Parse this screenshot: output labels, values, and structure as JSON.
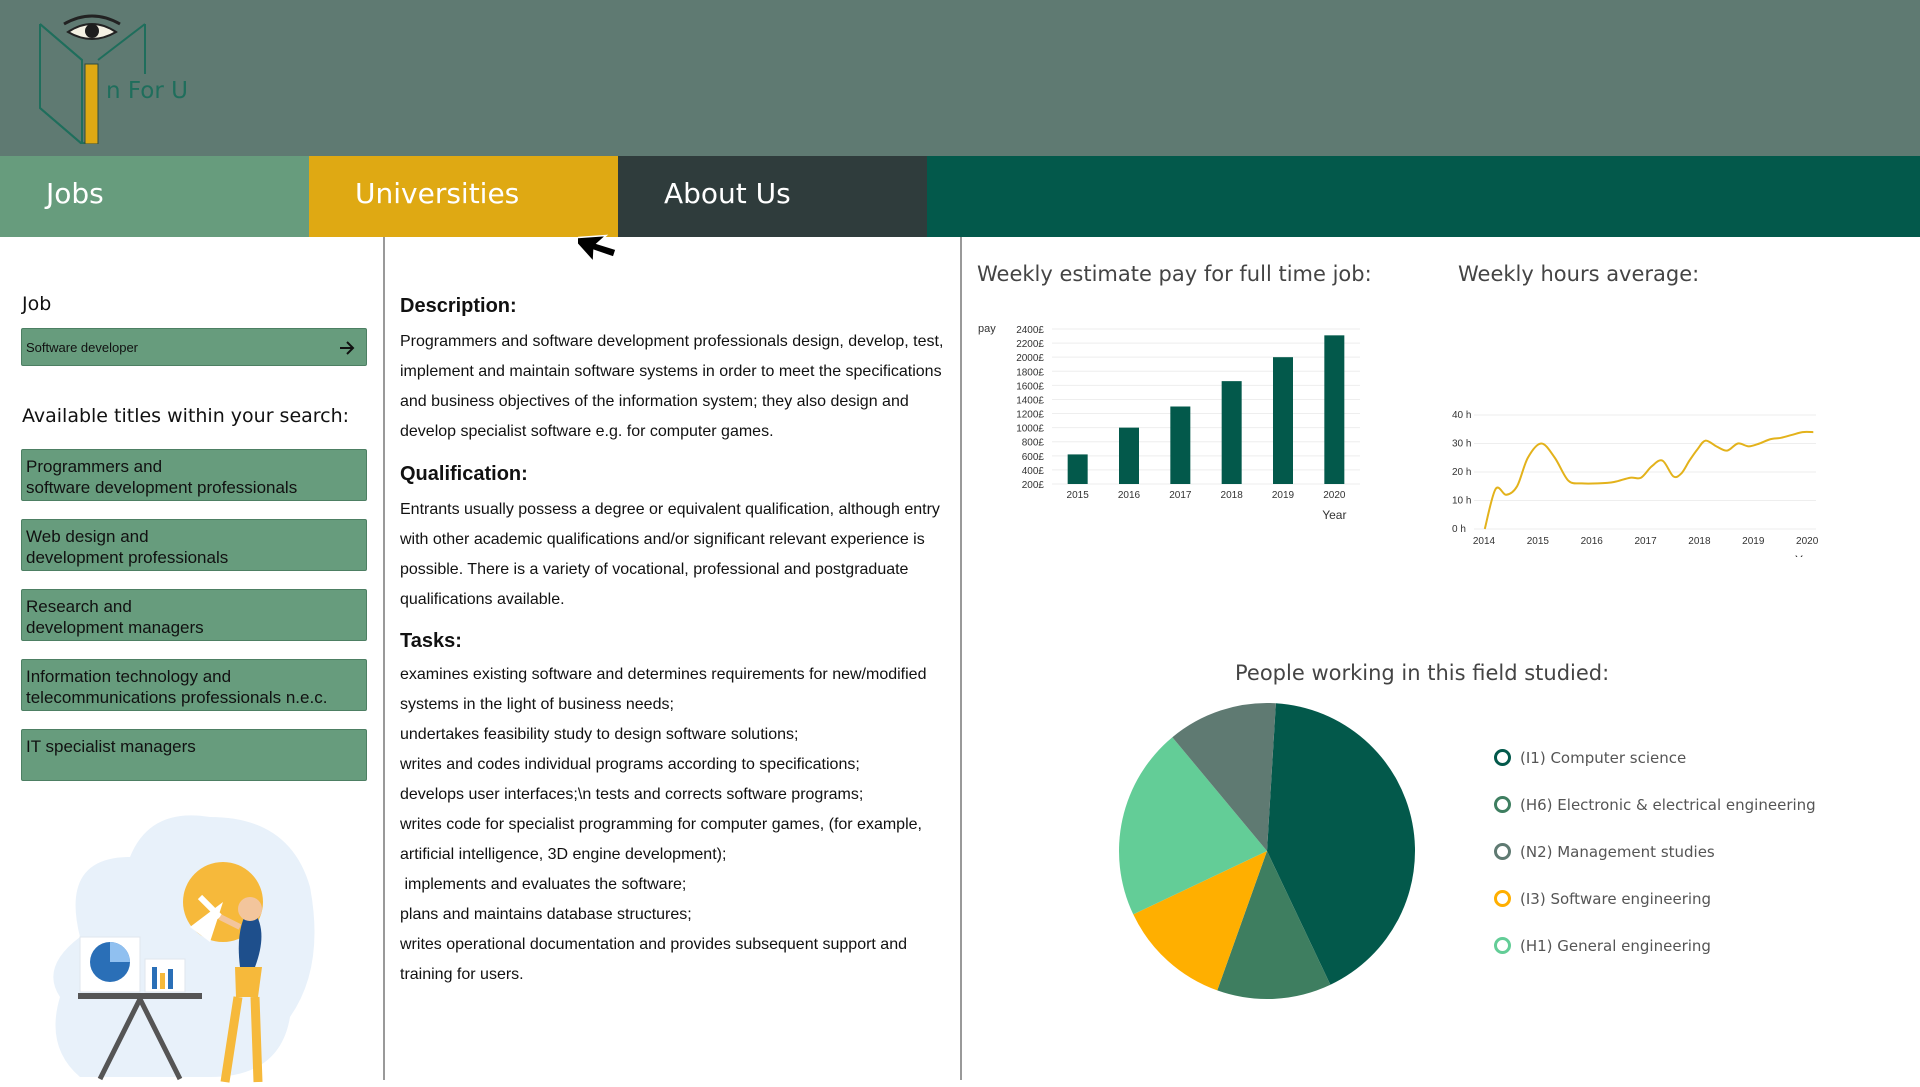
{
  "brand": {
    "logo_text": "n For U",
    "logo_letter": "I"
  },
  "nav": {
    "tabs": [
      {
        "label": "Jobs"
      },
      {
        "label": "Universities"
      },
      {
        "label": "About Us"
      }
    ]
  },
  "search": {
    "label": "Job",
    "value": "Software developer"
  },
  "available": {
    "heading": "Available titles within your search:",
    "titles": [
      [
        "Programmers and",
        "software development professionals"
      ],
      [
        "Web design and",
        "development professionals"
      ],
      [
        "Research and",
        "development managers"
      ],
      [
        "Information technology and",
        "telecommunications professionals n.e.c."
      ],
      [
        "IT specialist managers",
        ""
      ]
    ]
  },
  "details": {
    "description_heading": "Description:",
    "description": "Programmers and software development professionals design, develop, test, implement and maintain software systems in order to meet the specifications and business objectives of the information system; they also design and develop specialist software e.g. for computer games.",
    "qualification_heading": "Qualification:",
    "qualification": "Entrants usually possess a degree or equivalent qualification, although entry with other academic qualifications and/or significant relevant experience is possible. There is a variety of vocational, professional and postgraduate qualifications available.",
    "tasks_heading": "Tasks:",
    "tasks_lines": [
      "examines existing software and determines requirements for new/modified",
      "systems in the light of business needs;",
      "undertakes feasibility study to design software solutions;",
      "writes and codes individual programs according to specifications;",
      "develops user interfaces;\\n tests and corrects software programs;",
      "writes code for specialist programming for computer games, (for example,",
      "artificial intelligence, 3D engine development);",
      " implements and evaluates the software;",
      "plans and maintains database structures;",
      "writes operational documentation and provides subsequent support and",
      "training for users."
    ]
  },
  "colors": {
    "header": "#5f7a72",
    "nav": "#03594b",
    "tab_jobs": "#679c7d",
    "tab_universities": "#dfa913",
    "tab_about": "#2f3c3c",
    "bar": "#03594b",
    "line": "#e3b21b"
  },
  "chart_data": [
    {
      "type": "bar",
      "title": "Weekly estimate pay for full time job:",
      "xlabel": "Year",
      "ylabel": "pay",
      "categories": [
        "2015",
        "2016",
        "2017",
        "2018",
        "2019",
        "2020"
      ],
      "values": [
        620,
        1000,
        1300,
        1660,
        2000,
        2310
      ],
      "ylim": [
        200,
        2400
      ],
      "yticks": [
        "200£",
        "400£",
        "600£",
        "800£",
        "1000£",
        "1200£",
        "1400£",
        "1600£",
        "1800£",
        "2000£",
        "2200£",
        "2400£"
      ],
      "ytick_values": [
        200,
        400,
        600,
        800,
        1000,
        1200,
        1400,
        1600,
        1800,
        2000,
        2200,
        2400
      ],
      "grid": true
    },
    {
      "type": "line",
      "title": "Weekly hours average:",
      "xlabel": "Year",
      "xticks": [
        "2014",
        "2015",
        "2016",
        "2017",
        "2018",
        "2019",
        "2020"
      ],
      "xlim": [
        2014,
        2020.35
      ],
      "ylim": [
        0,
        40
      ],
      "yticks": [
        "0 h",
        "10 h",
        "20 h",
        "30 h",
        "40 h"
      ],
      "ytick_values": [
        0,
        10,
        20,
        30,
        40
      ],
      "x": [
        2014.2,
        2014.4,
        2014.6,
        2014.8,
        2015.0,
        2015.25,
        2015.5,
        2015.75,
        2016.0,
        2016.3,
        2016.6,
        2016.9,
        2017.1,
        2017.3,
        2017.5,
        2017.7,
        2017.85,
        2018.0,
        2018.15,
        2018.3,
        2018.5,
        2018.7,
        2018.9,
        2019.1,
        2019.3,
        2019.5,
        2019.7,
        2019.9,
        2020.1,
        2020.3
      ],
      "y": [
        0,
        14,
        12,
        15,
        25,
        30,
        25,
        17,
        16,
        16,
        16.5,
        18,
        18,
        22,
        24,
        18.5,
        19.5,
        24,
        28,
        31,
        29,
        27.5,
        30,
        29,
        30,
        31.5,
        32,
        33,
        34,
        34
      ],
      "grid": true
    },
    {
      "type": "pie",
      "title": "People working in this field studied:",
      "labels": [
        "(I1) Computer science",
        "(H6) Electronic & electrical engineering",
        "(N2) Management studies",
        "(I3) Software engineering",
        "(H1) General engineering"
      ],
      "legend_colors": [
        "#03594b",
        "#3e7e60",
        "#5f7a72",
        "#ffaf00",
        "#63cd97"
      ],
      "slices": [
        {
          "label": "(I1) Computer science",
          "value": 42,
          "color": "#03594b"
        },
        {
          "label": "(H6) Electronic & electrical engineering",
          "value": 12.5,
          "color": "#3e7e60"
        },
        {
          "label": "(I3) Software engineering",
          "value": 12.5,
          "color": "#ffaf00"
        },
        {
          "label": "(H1) General engineering",
          "value": 21,
          "color": "#63cd97"
        },
        {
          "label": "(N2) Management studies",
          "value": 12,
          "color": "#5f7a72"
        }
      ],
      "legend_position": "right"
    }
  ]
}
